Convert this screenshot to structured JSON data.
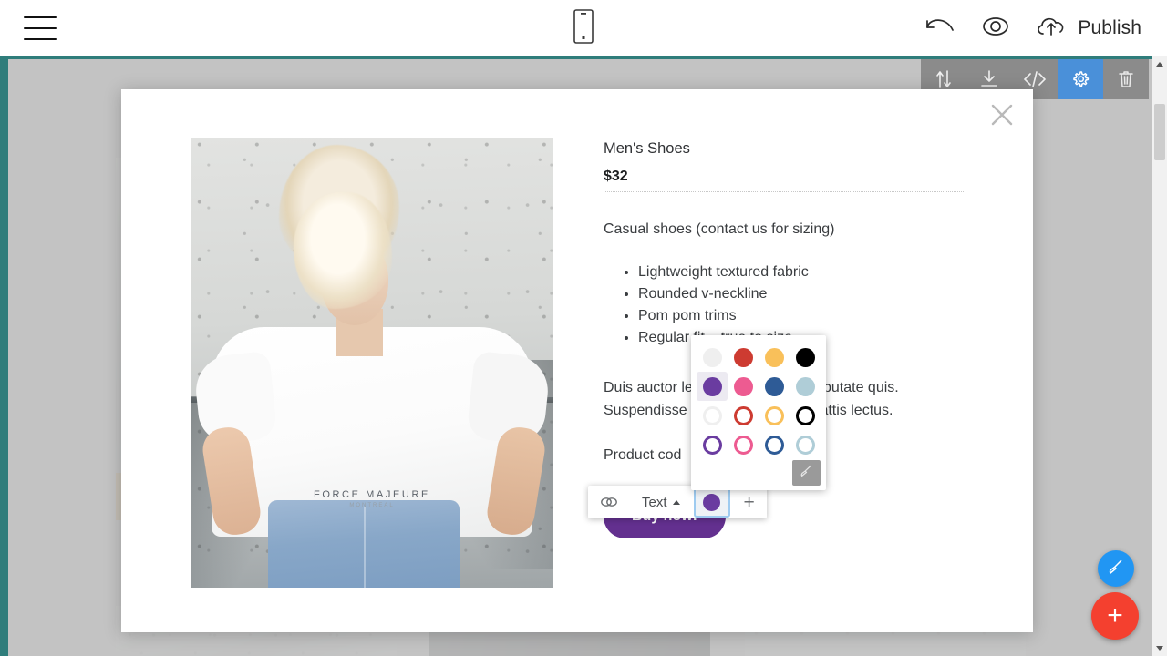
{
  "appbar": {
    "menu_icon": "hamburger-menu-icon",
    "device_icon": "mobile-preview-icon",
    "undo_icon": "undo-icon",
    "preview_icon": "eye-preview-icon",
    "publish_icon": "cloud-upload-icon",
    "publish_label": "Publish"
  },
  "element_toolbar": {
    "items": [
      {
        "name": "move-block-button",
        "icon": "up-down-arrows-icon",
        "active": false
      },
      {
        "name": "download-block-button",
        "icon": "download-icon",
        "active": false
      },
      {
        "name": "edit-code-button",
        "icon": "code-brackets-icon",
        "active": false
      },
      {
        "name": "block-settings-button",
        "icon": "gear-icon",
        "active": true
      },
      {
        "name": "delete-block-button",
        "icon": "trash-icon",
        "active": false
      }
    ],
    "active_color": "#4a90d9",
    "bar_color": "#8b8b8b"
  },
  "modal": {
    "close_icon": "close-x-icon",
    "photo_alt": "man-in-white-tshirt-photo",
    "photo_brand": "FORCE MAJEURE",
    "photo_brand_sub": "MONTREAL",
    "product": {
      "title": "Men's Shoes",
      "price": "$32",
      "description": "Casual shoes (contact us for sizing)",
      "features": [
        "Lightweight textured fabric",
        "Rounded v-neckline",
        "Pom pom trims",
        "Regular fit – true to size"
      ],
      "paragraph": "Duis auctor lectus ut lacinia ex vulputate quis. Suspendisse iaculis tortor, quis mattis lectus.",
      "paragraph_visible_lines": [
        "Duis auctor l                    cinia ex vulputate",
        "quis. Suspen                    ulis tortor, quis",
        "mattis lectus"
      ],
      "product_code_label": "Product cod",
      "buy_label": "Buy now!",
      "buy_color": "#63308f"
    }
  },
  "inline_toolbar": {
    "link_icon": "link-chain-icon",
    "style_label": "Text",
    "style_caret": "caret-up-icon",
    "selected_color": "#6a3ca0",
    "add_label": "+"
  },
  "color_picker": {
    "rows": [
      {
        "style": "filled",
        "colors": [
          "#efefef",
          "#cd3b31",
          "#f9c05a",
          "#000000"
        ]
      },
      {
        "style": "filled",
        "colors": [
          "#6a3ca0",
          "#ed5b91",
          "#2e5b96",
          "#afcdd7"
        ]
      },
      {
        "style": "outline",
        "colors": [
          "#efefef",
          "#cd3b31",
          "#f9c05a",
          "#000000"
        ]
      },
      {
        "style": "outline",
        "colors": [
          "#6a3ca0",
          "#ed5b91",
          "#2e5b96",
          "#afcdd7"
        ]
      }
    ],
    "selected_row": 1,
    "selected_col": 0,
    "brush_icon": "paintbrush-icon"
  },
  "fabs": [
    {
      "name": "site-style-fab",
      "icon": "paintbrush-icon",
      "color": "#2196f3",
      "label": ""
    },
    {
      "name": "add-block-fab",
      "icon": "plus-icon",
      "color": "#f4402f",
      "label": "+"
    }
  ],
  "scrollbar": {
    "up_icon": "scroll-up-arrow-icon",
    "down_icon": "scroll-down-arrow-icon"
  },
  "canvas": {
    "accent_border": "#2f7d7b",
    "overlay_color": "#c3c3c3"
  }
}
